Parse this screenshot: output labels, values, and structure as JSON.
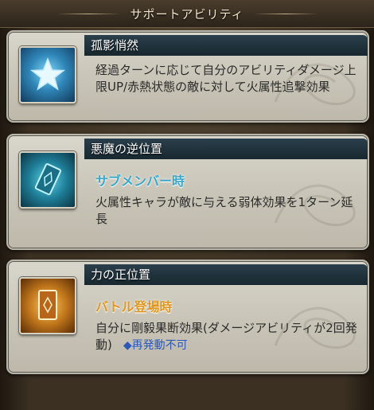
{
  "header": {
    "title": "サポートアビリティ"
  },
  "abilities": [
    {
      "title": "孤影悄然",
      "icon": "star-icon",
      "sub_label": "",
      "description": "経過ターンに応じて自分のアビリティダメージ上限UP/赤熱状態の敵に対して火属性追撃効果",
      "note": ""
    },
    {
      "title": "悪魔の逆位置",
      "icon": "reversed-card-icon",
      "sub_label": "サブメンバー時",
      "sub_label_color": "#3aa7c9",
      "description": "火属性キャラが敵に与える弱体効果を1ターン延長",
      "note": ""
    },
    {
      "title": "力の正位置",
      "icon": "upright-card-icon",
      "sub_label": "バトル登場時",
      "sub_label_color": "#e0961f",
      "description": "自分に剛毅果断効果(ダメージアビリティが2回発動)",
      "note": "◆再発動不可"
    }
  ]
}
